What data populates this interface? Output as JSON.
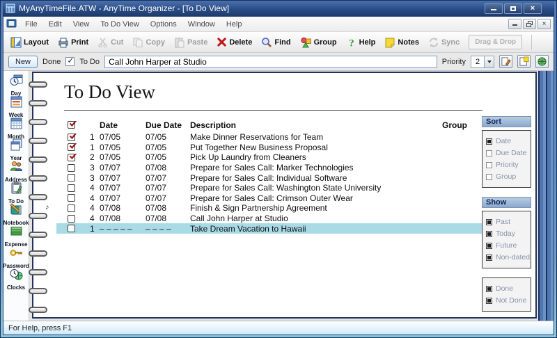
{
  "window": {
    "title": "MyAnyTimeFile.ATW - AnyTime Organizer - [To Do View]"
  },
  "menu": {
    "items": [
      "File",
      "Edit",
      "View",
      "To Do View",
      "Options",
      "Window",
      "Help"
    ]
  },
  "toolbar": {
    "buttons": [
      {
        "label": "Layout",
        "icon": "layout-icon",
        "disabled": false
      },
      {
        "label": "Print",
        "icon": "print-icon",
        "disabled": false
      },
      {
        "label": "Cut",
        "icon": "cut-icon",
        "disabled": true
      },
      {
        "label": "Copy",
        "icon": "copy-icon",
        "disabled": true
      },
      {
        "label": "Paste",
        "icon": "paste-icon",
        "disabled": true
      },
      {
        "label": "Delete",
        "icon": "delete-icon",
        "disabled": false
      },
      {
        "label": "Find",
        "icon": "find-icon",
        "disabled": false
      },
      {
        "label": "Group",
        "icon": "group-icon",
        "disabled": false
      },
      {
        "label": "Help",
        "icon": "help-icon",
        "disabled": false
      },
      {
        "label": "Notes",
        "icon": "notes-icon",
        "disabled": false
      },
      {
        "label": "Sync",
        "icon": "sync-icon",
        "disabled": true
      }
    ],
    "drag_drop_label": "Drag & Drop"
  },
  "edit_row": {
    "new_button": "New",
    "done_label": "Done",
    "todo_label": "To Do",
    "todo_checked": true,
    "input_value": "Call John Harper at Studio",
    "priority_label": "Priority",
    "priority_value": "2"
  },
  "sidebar": {
    "items": [
      {
        "label": "Day",
        "icon": "day-icon"
      },
      {
        "label": "Week",
        "icon": "week-icon"
      },
      {
        "label": "Month",
        "icon": "month-icon"
      },
      {
        "label": "Year",
        "icon": "year-icon"
      },
      {
        "label": "Address",
        "icon": "address-icon"
      },
      {
        "label": "To Do",
        "icon": "todo-icon"
      },
      {
        "label": "Notebook",
        "icon": "notebook-icon"
      },
      {
        "label": "Expense",
        "icon": "expense-icon"
      },
      {
        "label": "Password",
        "icon": "password-icon"
      },
      {
        "label": "Clocks",
        "icon": "clocks-icon"
      }
    ]
  },
  "page": {
    "title": "To Do View"
  },
  "table": {
    "headers": {
      "date": "Date",
      "due_date": "Due Date",
      "description": "Description",
      "group": "Group"
    },
    "rows": [
      {
        "done": true,
        "priority": "1",
        "date": "07/05",
        "due": "07/05",
        "desc": "Make Dinner Reservations for Team",
        "group": "",
        "selected": false,
        "alarm": false
      },
      {
        "done": true,
        "priority": "1",
        "date": "07/05",
        "due": "07/05",
        "desc": "Put Together New Business Proposal",
        "group": "",
        "selected": false,
        "alarm": false
      },
      {
        "done": true,
        "priority": "2",
        "date": "07/05",
        "due": "07/05",
        "desc": "Pick Up Laundry from Cleaners",
        "group": "",
        "selected": false,
        "alarm": false
      },
      {
        "done": false,
        "priority": "3",
        "date": "07/07",
        "due": "07/08",
        "desc": "Prepare for Sales Call: Marker Technologies",
        "group": "",
        "selected": false,
        "alarm": false
      },
      {
        "done": false,
        "priority": "3",
        "date": "07/07",
        "due": "07/07",
        "desc": "Prepare for Sales Call: Individual Software",
        "group": "",
        "selected": false,
        "alarm": false
      },
      {
        "done": false,
        "priority": "4",
        "date": "07/07",
        "due": "07/07",
        "desc": "Prepare for Sales Call: Washington State University",
        "group": "",
        "selected": false,
        "alarm": false
      },
      {
        "done": false,
        "priority": "4",
        "date": "07/07",
        "due": "07/07",
        "desc": "Prepare for Sales Call: Crimson Outer Wear",
        "group": "",
        "selected": false,
        "alarm": false
      },
      {
        "done": false,
        "priority": "4",
        "date": "07/08",
        "due": "07/08",
        "desc": "Finish & Sign Partnership Agreement",
        "group": "",
        "selected": false,
        "alarm": true
      },
      {
        "done": false,
        "priority": "4",
        "date": "07/08",
        "due": "07/08",
        "desc": "Call John Harper at Studio",
        "group": "",
        "selected": false,
        "alarm": false
      },
      {
        "done": false,
        "priority": "1",
        "date": "– – – – –",
        "due": "– – – –",
        "desc": "Take Dream Vacation to Hawaii",
        "group": "",
        "selected": true,
        "alarm": false
      }
    ]
  },
  "panels": [
    {
      "title": "Sort",
      "items": [
        {
          "label": "Date",
          "checked": true
        },
        {
          "label": "Due Date",
          "checked": false
        },
        {
          "label": "Priority",
          "checked": false
        },
        {
          "label": "Group",
          "checked": false
        }
      ]
    },
    {
      "title": "Show",
      "items": [
        {
          "label": "Past",
          "checked": true
        },
        {
          "label": "Today",
          "checked": true
        },
        {
          "label": "Future",
          "checked": true
        },
        {
          "label": "Non-dated",
          "checked": true
        }
      ]
    },
    {
      "title": "",
      "items": [
        {
          "label": "Done",
          "checked": true
        },
        {
          "label": "Not Done",
          "checked": true
        }
      ]
    }
  ],
  "status_bar": {
    "text": "For Help, press F1"
  },
  "colors": {
    "titlebar": "#27477e",
    "selection": "#a9dbe7",
    "check_red": "#9b1b1b",
    "panel_header": "#8fadd0"
  }
}
